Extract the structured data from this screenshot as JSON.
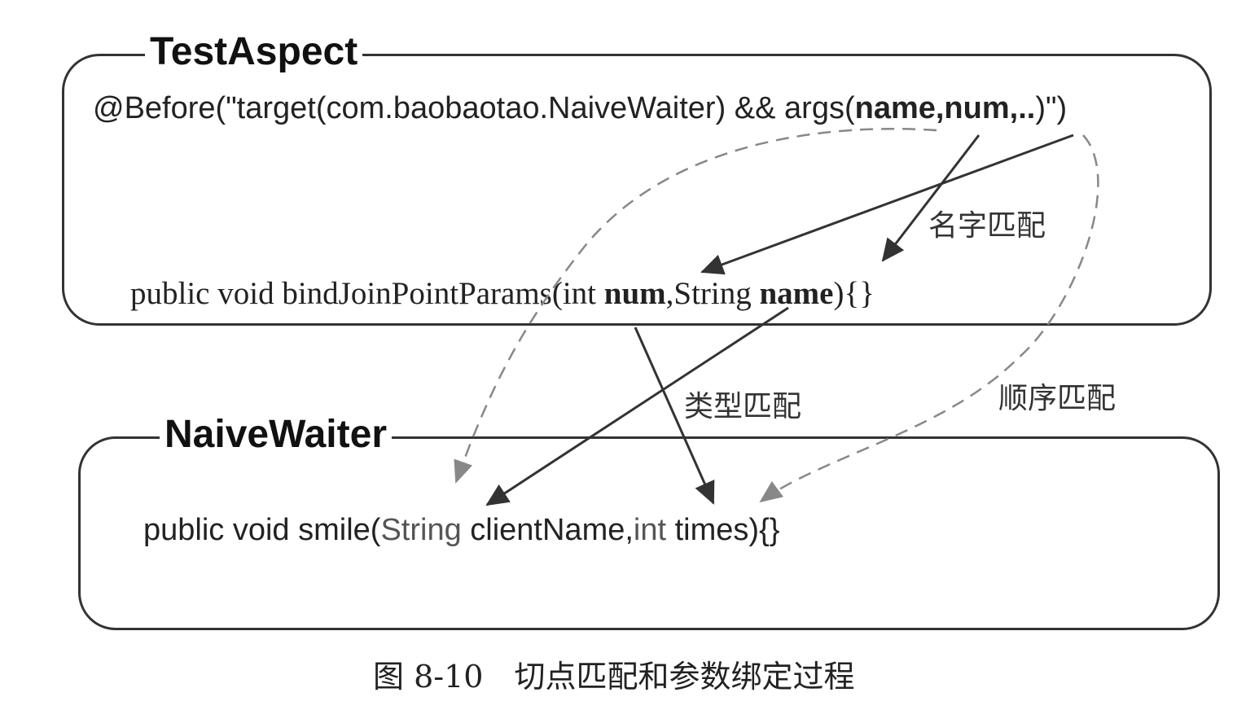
{
  "test_aspect": {
    "title": "TestAspect",
    "before": {
      "prefix": "@Before(\"target(com.baobaotao.NaiveWaiter) && args(",
      "args": "name,num,..",
      "suffix": ")\")"
    },
    "method": {
      "prefix": "public void bindJoinPointParams(",
      "p1_type": "int ",
      "p1_name": "num",
      "sep": ",",
      "p2_type": "String ",
      "p2_name": "name",
      "suffix": "){}"
    }
  },
  "naive_waiter": {
    "title": "NaiveWaiter",
    "method": {
      "prefix": "public void smile(",
      "p1_type": "String ",
      "p1_name": "clientName",
      "sep": ",",
      "p2_type": "int ",
      "p2_name": "times",
      "suffix": "){}"
    }
  },
  "labels": {
    "name_match": "名字匹配",
    "type_match": "类型匹配",
    "order_match": "顺序匹配"
  },
  "caption": "图 8-10　切点匹配和参数绑定过程",
  "colors": {
    "line": "#333333",
    "dashed": "#888888",
    "text": "#222222"
  }
}
